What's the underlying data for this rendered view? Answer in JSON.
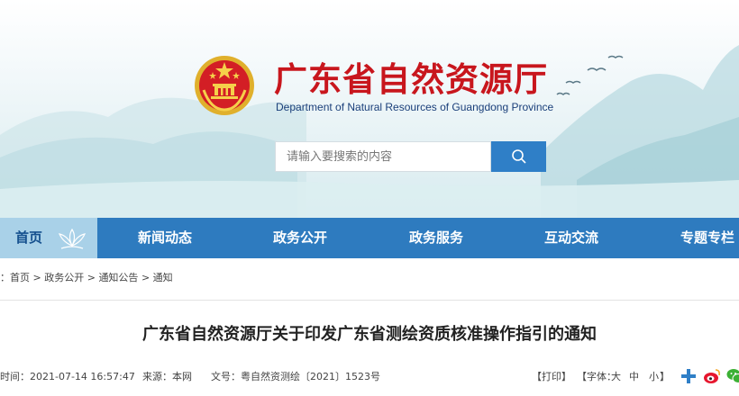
{
  "header": {
    "title": "广东省自然资源厅",
    "subtitle": "Department of Natural Resources of Guangdong Province",
    "emblem_icon": "national-emblem-icon",
    "brand_color": "#c8161d"
  },
  "search": {
    "placeholder": "请输入要搜索的内容",
    "button_icon": "search-icon",
    "button_color": "#2f7fc7"
  },
  "nav": {
    "items": [
      {
        "label": "首页",
        "active": true
      },
      {
        "label": "新闻动态"
      },
      {
        "label": "政务公开"
      },
      {
        "label": "政务服务"
      },
      {
        "label": "互动交流"
      },
      {
        "label": "专题专栏"
      }
    ],
    "bar_color": "#2e7bbf",
    "active_color": "#a9d1e8"
  },
  "breadcrumb": {
    "prefix": "：",
    "items": [
      "首页",
      "政务公开",
      "通知公告",
      "通知"
    ],
    "separator": ">"
  },
  "article": {
    "title": "广东省自然资源厅关于印发广东省测绘资质核准操作指引的通知",
    "time": "时间：2021-07-14 16:57:47",
    "source": "来源：本网",
    "doc_number": "文号：粤自然资测绘〔2021〕1523号",
    "print": "【打印】",
    "font_size_label": "【字体：",
    "font_large": "大",
    "font_medium": "中",
    "font_small": "小",
    "font_close": "】"
  },
  "share": {
    "icons": [
      "share-plus-icon",
      "weibo-icon",
      "wechat-icon"
    ]
  }
}
